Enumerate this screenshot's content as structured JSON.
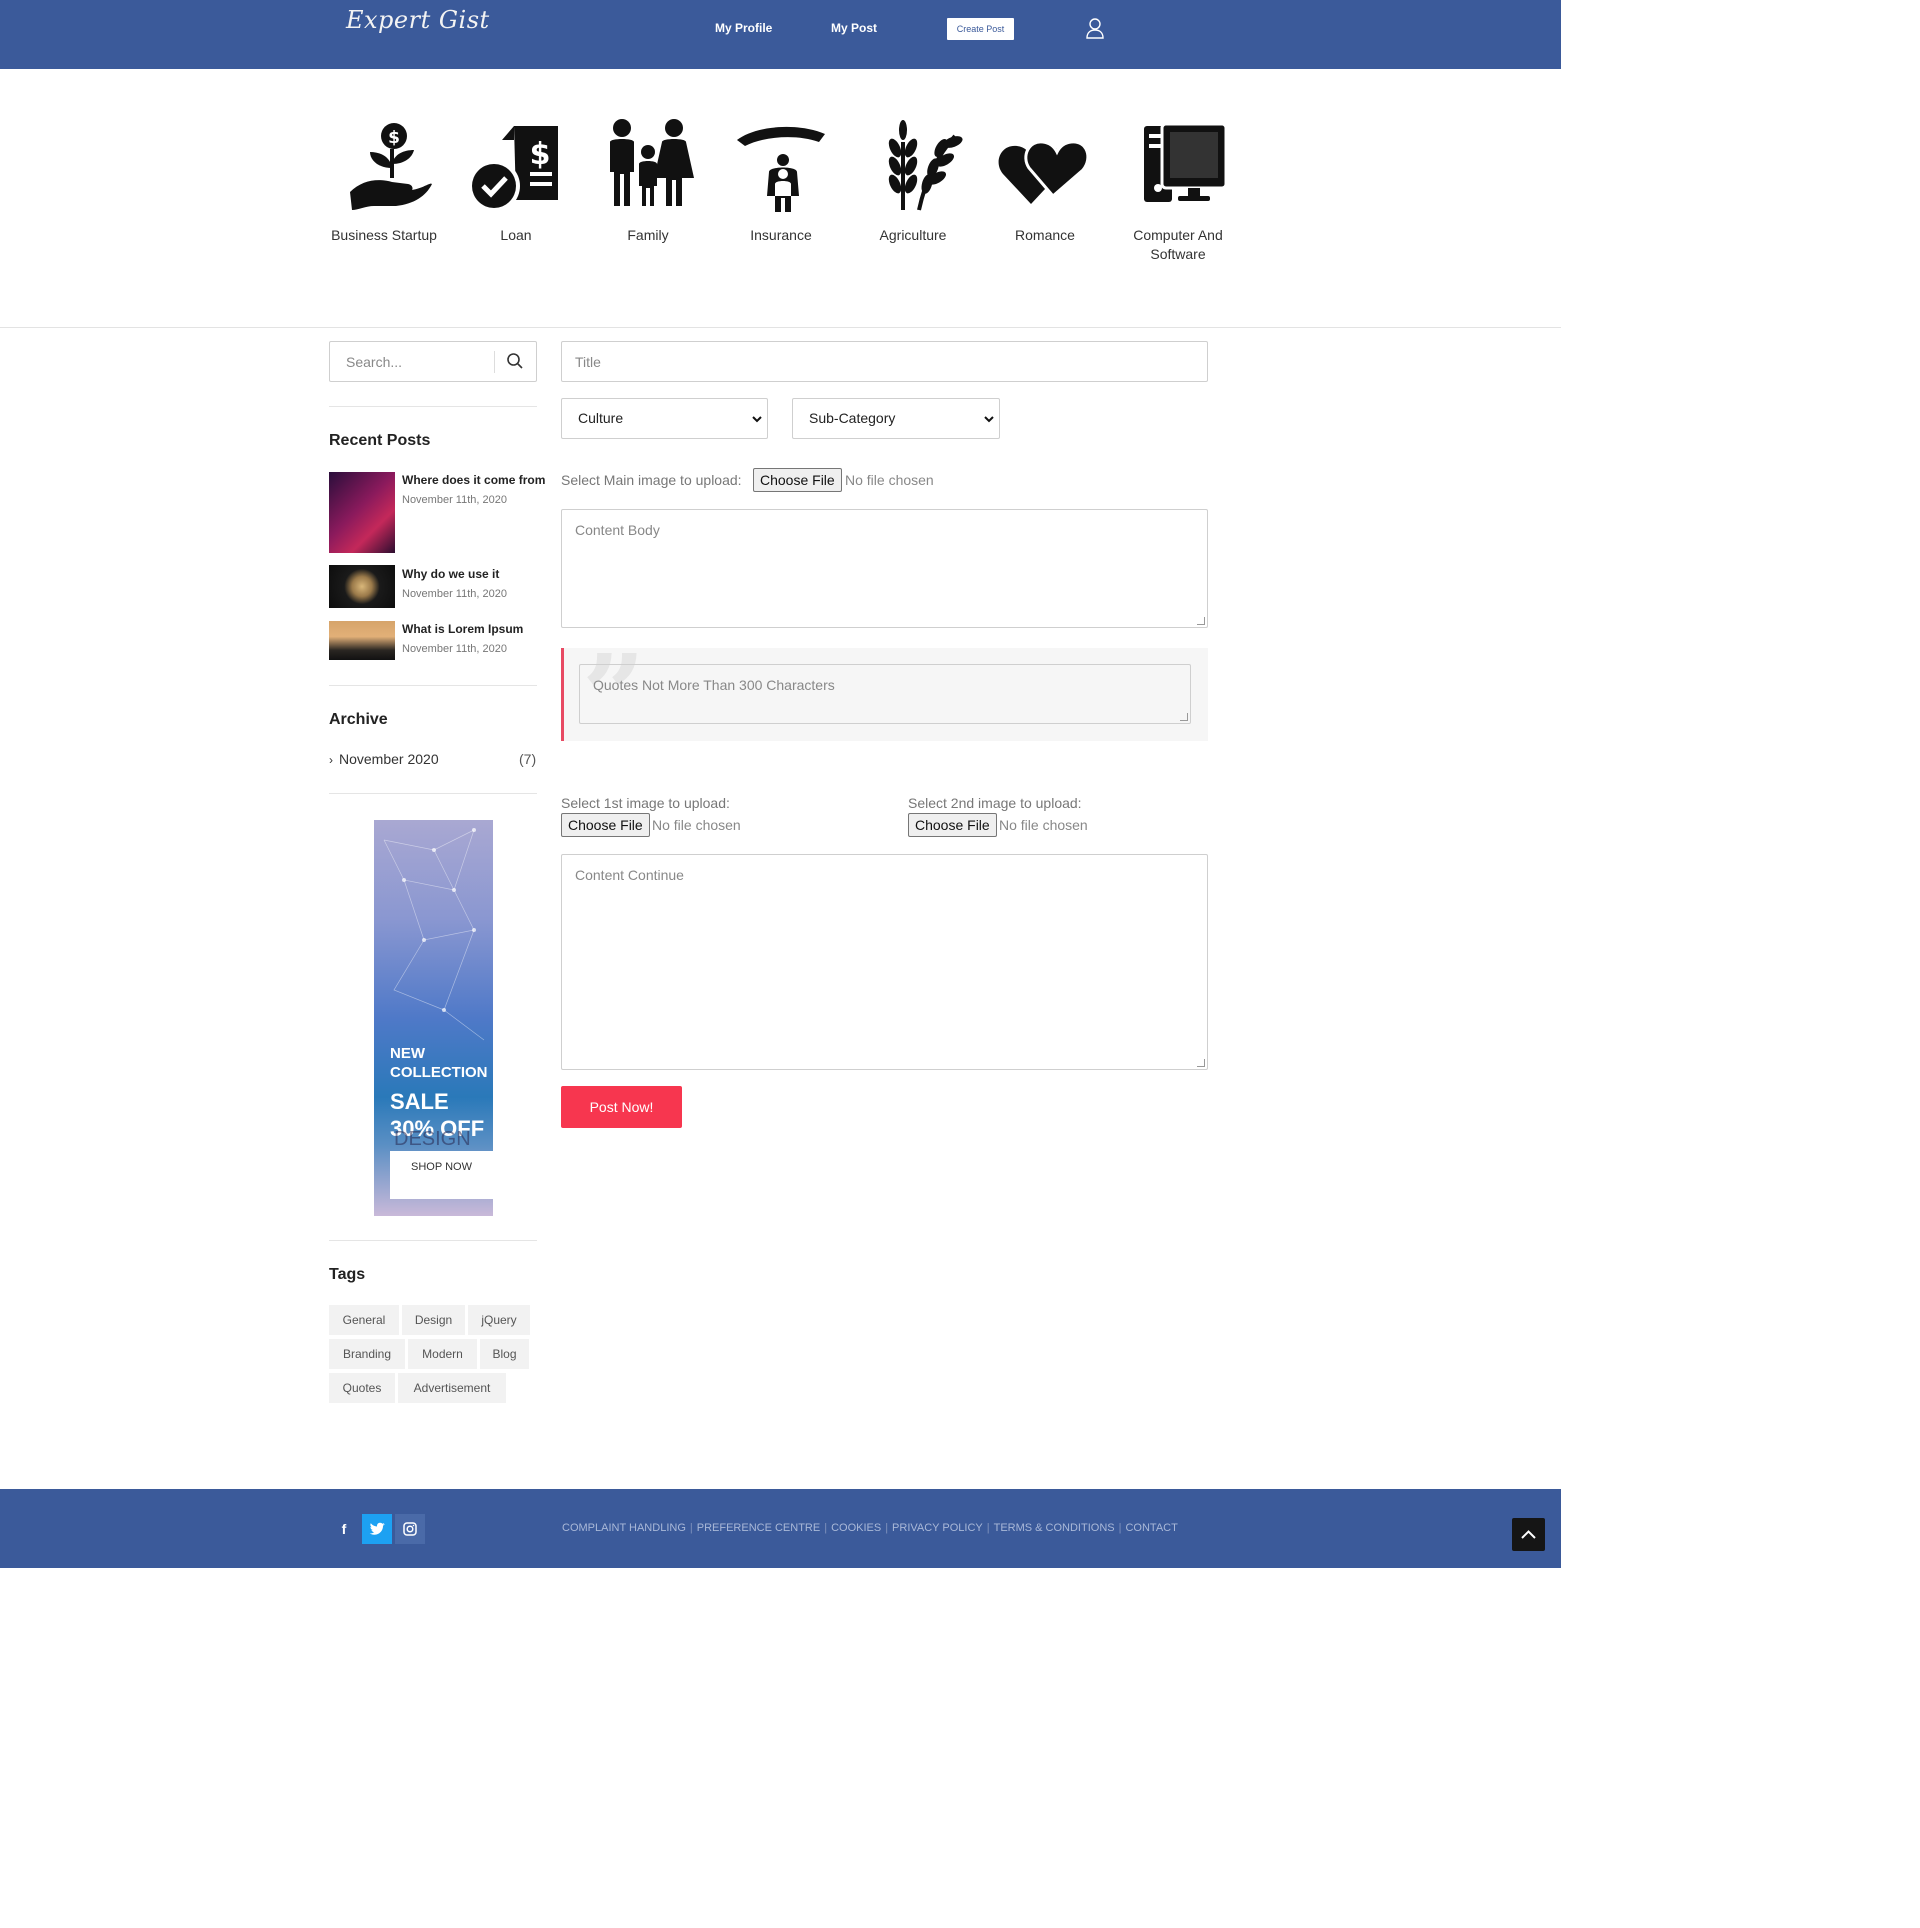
{
  "header": {
    "logo": "Expert Gist",
    "nav": [
      "My Profile",
      "My Post"
    ],
    "create_post": "Create Post",
    "icon": "user-icon"
  },
  "categories": [
    {
      "label": "Business Startup",
      "icon": "hand-plant-dollar-icon"
    },
    {
      "label": "Loan",
      "icon": "loan-document-check-icon"
    },
    {
      "label": "Family",
      "icon": "family-icon"
    },
    {
      "label": "Insurance",
      "icon": "insurance-umbrella-hand-icon"
    },
    {
      "label": "Agriculture",
      "icon": "wheat-icon"
    },
    {
      "label": "Romance",
      "icon": "two-hearts-icon"
    },
    {
      "label": "Computer And Software",
      "icon": "desktop-computer-icon"
    }
  ],
  "sidebar": {
    "search_placeholder": "Search...",
    "recent_posts_title": "Recent Posts",
    "recent_posts": [
      {
        "title": "Where does it come from",
        "date": "November 11th, 2020"
      },
      {
        "title": "Why do we use it",
        "date": "November 11th, 2020"
      },
      {
        "title": "What is Lorem Ipsum",
        "date": "November 11th, 2020"
      }
    ],
    "archive_title": "Archive",
    "archive": [
      {
        "label": "November 2020",
        "count": "(7)"
      }
    ],
    "ad": {
      "line1": "NEW",
      "line2": "COLLECTION",
      "line3": "SALE",
      "line4": "30% OFF",
      "line5": "DESIGN",
      "button": "SHOP NOW"
    },
    "tags_title": "Tags",
    "tags": [
      "General",
      "Design",
      "jQuery",
      "Branding",
      "Modern",
      "Blog",
      "Quotes",
      "Advertisement"
    ]
  },
  "form": {
    "title_placeholder": "Title",
    "category_value": "Culture",
    "subcategory_value": "Sub-Category",
    "main_image_label": "Select Main image to upload:",
    "choose_file": "Choose File",
    "no_file": "No file chosen",
    "content_body_placeholder": "Content Body",
    "quote_placeholder": "Quotes Not More Than 300 Characters",
    "image1_label": "Select 1st image to upload:",
    "image2_label": "Select 2nd image to upload:",
    "content_continue_placeholder": "Content Continue",
    "submit": "Post Now!"
  },
  "footer": {
    "social": [
      "f",
      "twitter",
      "instagram"
    ],
    "links": [
      "COMPLAINT HANDLING",
      "PREFERENCE CENTRE",
      "COOKIES",
      "PRIVACY POLICY",
      "TERMS & CONDITIONS",
      "CONTACT"
    ]
  },
  "colors": {
    "header_bg": "#3b5a9a",
    "accent": "#f7364f",
    "twitter": "#1da1f2"
  }
}
